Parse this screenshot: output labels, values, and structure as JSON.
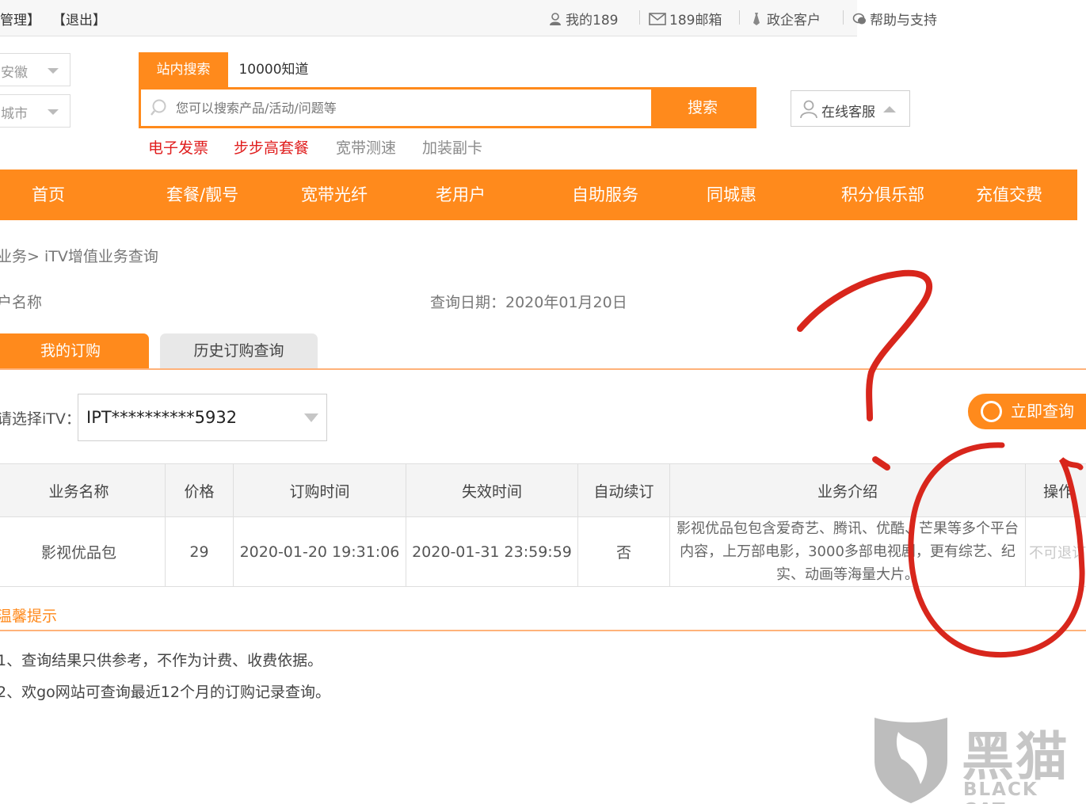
{
  "topbar": {
    "manage": "管理】",
    "logout": "【退出】",
    "my189": "我的189",
    "mail189": "189邮箱",
    "enterprise": "政企客户",
    "help": "帮助与支持"
  },
  "region": {
    "province": "安徽",
    "city": "城市"
  },
  "search": {
    "tab_active": "站内搜索",
    "tab_other": "10000知道",
    "placeholder": "您可以搜索产品/活动/问题等",
    "button": "搜索",
    "hot_links": [
      "电子发票",
      "步步高套餐",
      "宽带测速",
      "加装副卡"
    ]
  },
  "kefu": {
    "label": "在线客服"
  },
  "nav": [
    "首页",
    "套餐/靓号",
    "宽带光纤",
    "老用户",
    "自助服务",
    "同城惠",
    "积分俱乐部",
    "充值交费"
  ],
  "breadcrumb": "业务> iTV增值业务查询",
  "account_label": "户名称",
  "query_date": "查询日期：2020年01月20日",
  "tabs": {
    "mine": "我的订购",
    "history": "历史订购查询"
  },
  "itv": {
    "label": "请选择iTV：",
    "value": "IPT**********5932",
    "query_button": "立即查询"
  },
  "table": {
    "headers": [
      "业务名称",
      "价格",
      "订购时间",
      "失效时间",
      "自动续订",
      "业务介绍",
      "操作"
    ],
    "rows": [
      {
        "name": "影视优品包",
        "price": "29",
        "order_time": "2020-01-20 19:31:06",
        "expire_time": "2020-01-31 23:59:59",
        "auto_renew": "否",
        "desc": "影视优品包包含爱奇艺、腾讯、优酷、芒果等多个平台内容，上万部电影，3000多部电视剧，更有综艺、纪实、动画等海量大片。",
        "op": "不可退订"
      }
    ]
  },
  "tips": {
    "title": "温馨提示",
    "items": [
      "1、查询结果只供参考，不作为计费、收费依据。",
      "2、欢go网站可查询最近12个月的订购记录查询。"
    ]
  },
  "watermark": {
    "cn": "黑猫",
    "en": "BLACK CAT"
  },
  "colors": {
    "accent": "#ff8a1c",
    "hot_red": "#e01c1c",
    "scribble": "#d8261c"
  }
}
